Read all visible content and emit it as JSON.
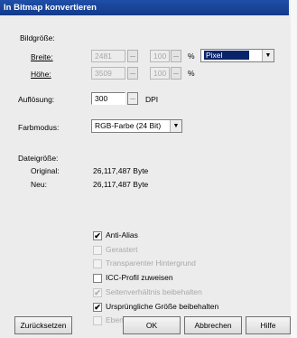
{
  "window": {
    "title": "In Bitmap konvertieren",
    "close_glyph": "x"
  },
  "groesse": {
    "heading": "Bildgröße:",
    "breite_label": "Breite:",
    "hoehe_label": "Höhe:",
    "breite_value": "2481",
    "hoehe_value": "3509",
    "breite_pct": "100",
    "hoehe_pct": "100",
    "pct_symbol": "%",
    "unit_value": "Pixel"
  },
  "aufloesung": {
    "label": "Auflösung:",
    "value": "300",
    "unit": "DPI"
  },
  "farbmodus": {
    "label": "Farbmodus:",
    "value": "RGB-Farbe (24 Bit)"
  },
  "dateigroesse": {
    "heading": "Dateigröße:",
    "original_label": "Original:",
    "original_value": "26,117,487 Byte",
    "neu_label": "Neu:",
    "neu_value": "26,117,487 Byte"
  },
  "options": [
    {
      "label": "Anti-Alias",
      "checked": true,
      "enabled": true
    },
    {
      "label": "Gerastert",
      "checked": false,
      "enabled": false
    },
    {
      "label": "Transparenter Hintergrund",
      "checked": false,
      "enabled": false
    },
    {
      "label": "ICC-Profil zuweisen",
      "checked": false,
      "enabled": true
    },
    {
      "label": "Seitenverhältnis beibehalten",
      "checked": true,
      "enabled": false
    },
    {
      "label": "Ursprüngliche Größe beibehalten",
      "checked": true,
      "enabled": true
    },
    {
      "label": "Ebenen erhalten",
      "checked": false,
      "enabled": false
    }
  ],
  "buttons": {
    "reset": "Zurücksetzen",
    "ok": "OK",
    "cancel": "Abbrechen",
    "help": "Hilfe"
  },
  "check_glyph": "✔",
  "colors": {
    "titlebar": "#1f4fa8",
    "selection": "#0a246a"
  }
}
